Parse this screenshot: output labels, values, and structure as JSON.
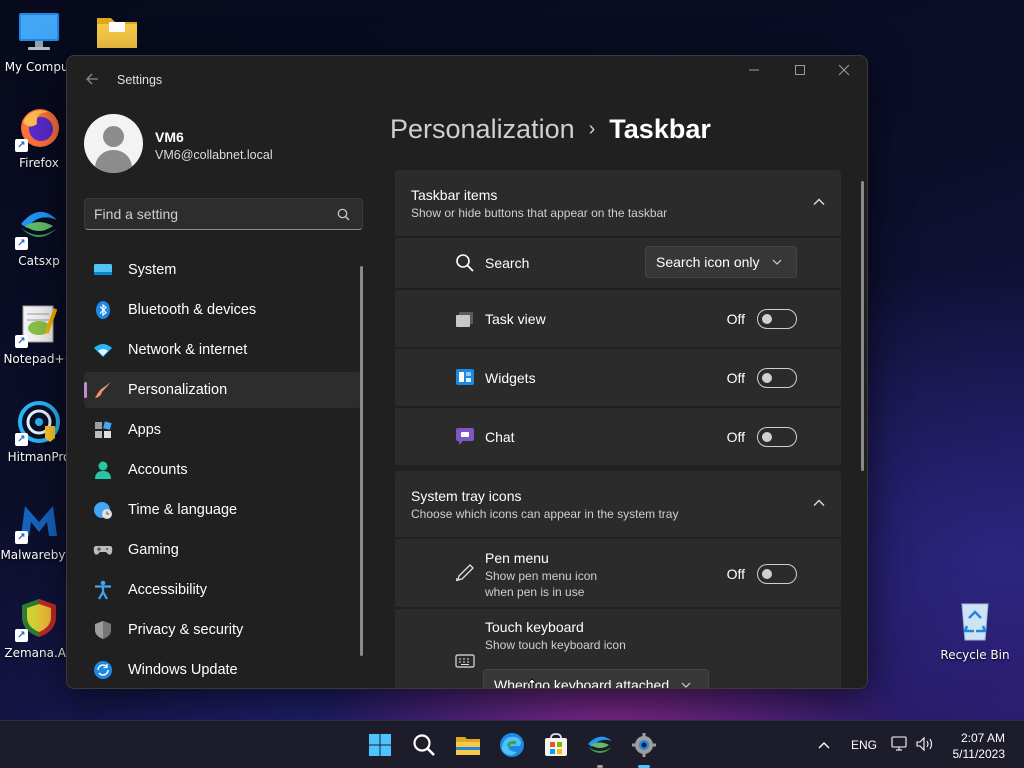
{
  "desktop": {
    "icons_left": [
      {
        "label": "My Comput",
        "icon": "monitor-icon"
      },
      {
        "label": "",
        "icon": "folder-icon"
      },
      {
        "label": "Firefox",
        "icon": "firefox-icon"
      },
      {
        "label": "Catsxp",
        "icon": "catsxp-icon"
      },
      {
        "label": "Notepad++",
        "icon": "notepadpp-icon"
      },
      {
        "label": "HitmanPro",
        "icon": "hitmanpro-icon"
      },
      {
        "label": "Malwarebyte",
        "icon": "malwarebytes-icon"
      },
      {
        "label": "Zemana.An",
        "icon": "zemana-icon"
      }
    ],
    "recycle_bin": {
      "label": "Recycle Bin",
      "icon": "recycle-bin-icon"
    }
  },
  "window": {
    "title": "Settings",
    "controls": {
      "minimize": "—",
      "maximize": "☐",
      "close": "✕"
    }
  },
  "profile": {
    "name": "VM6",
    "email": "VM6@collabnet.local"
  },
  "search": {
    "placeholder": "Find a setting"
  },
  "nav": {
    "items": [
      {
        "label": "System",
        "icon": "system-icon"
      },
      {
        "label": "Bluetooth & devices",
        "icon": "bluetooth-icon"
      },
      {
        "label": "Network & internet",
        "icon": "wifi-icon"
      },
      {
        "label": "Personalization",
        "icon": "brush-icon",
        "active": true
      },
      {
        "label": "Apps",
        "icon": "apps-icon"
      },
      {
        "label": "Accounts",
        "icon": "accounts-icon"
      },
      {
        "label": "Time & language",
        "icon": "globe-clock-icon"
      },
      {
        "label": "Gaming",
        "icon": "gamepad-icon"
      },
      {
        "label": "Accessibility",
        "icon": "accessibility-icon"
      },
      {
        "label": "Privacy & security",
        "icon": "shield-icon"
      },
      {
        "label": "Windows Update",
        "icon": "update-icon"
      }
    ]
  },
  "breadcrumb": {
    "parent": "Personalization",
    "separator": "›",
    "current": "Taskbar"
  },
  "sections": {
    "taskbar_items": {
      "title": "Taskbar items",
      "subtitle": "Show or hide buttons that appear on the taskbar",
      "rows": {
        "search": {
          "label": "Search",
          "value": "Search icon only"
        },
        "task_view": {
          "label": "Task view",
          "state": "Off"
        },
        "widgets": {
          "label": "Widgets",
          "state": "Off"
        },
        "chat": {
          "label": "Chat",
          "state": "Off"
        }
      }
    },
    "system_tray": {
      "title": "System tray icons",
      "subtitle": "Choose which icons can appear in the system tray",
      "rows": {
        "pen_menu": {
          "label": "Pen menu",
          "sub1": "Show pen menu icon",
          "sub2": "when pen is in use",
          "state": "Off"
        },
        "touch_keyboard": {
          "label": "Touch keyboard",
          "sub": "Show touch keyboard icon",
          "value": "When no keyboard attached"
        }
      }
    }
  },
  "taskbar": {
    "tray": {
      "language": "ENG",
      "time": "2:07 AM",
      "date": "5/11/2023"
    }
  },
  "colors": {
    "accent": "#c18bd8",
    "window_bg": "#202020",
    "card_bg": "#2b2b2b"
  }
}
